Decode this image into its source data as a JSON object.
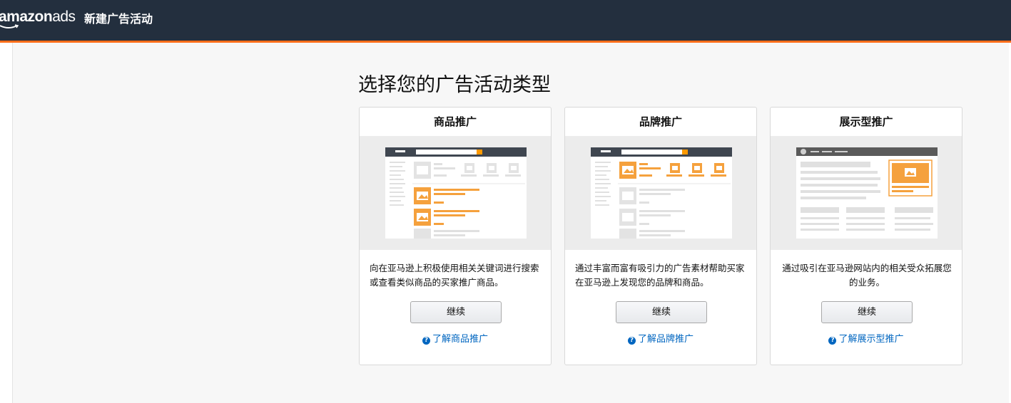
{
  "topbar": {
    "logo_bold": "amazon",
    "logo_light": "ads",
    "page_heading": "新建广告活动"
  },
  "main": {
    "section_title": "选择您的广告活动类型",
    "cards": [
      {
        "title": "商品推广",
        "description": "向在亚马逊上积极使用相关关键词进行搜索或查看类似商品的买家推广商品。",
        "button_label": "继续",
        "learn_label": "了解商品推广"
      },
      {
        "title": "品牌推广",
        "description": "通过丰富而富有吸引力的广告素材帮助买家在亚马逊上发现您的品牌和商品。",
        "button_label": "继续",
        "learn_label": "了解品牌推广"
      },
      {
        "title": "展示型推广",
        "description": "通过吸引在亚马逊网站内的相关受众拓展您的业务。",
        "button_label": "继续",
        "learn_label": "了解展示型推广"
      }
    ]
  },
  "colors": {
    "topbar": "#232f3e",
    "accent_orange": "#ff9900",
    "link_blue": "#0066c0"
  }
}
